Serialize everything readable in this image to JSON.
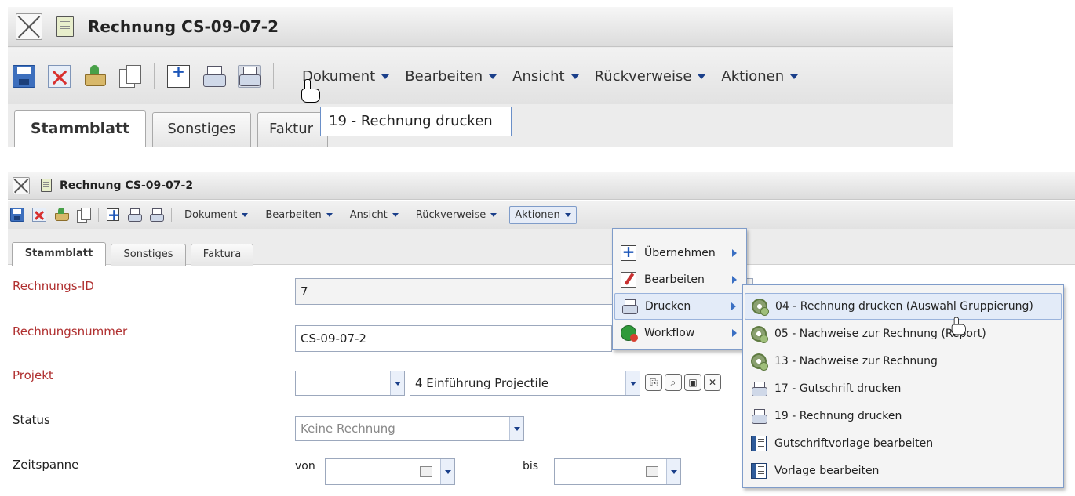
{
  "top": {
    "title": "Rechnung CS-09-07-2",
    "menus": [
      "Dokument",
      "Bearbeiten",
      "Ansicht",
      "Rückverweise",
      "Aktionen"
    ],
    "tabs": [
      "Stammblatt",
      "Sonstiges",
      "Faktur"
    ],
    "tooltip": "19 - Rechnung drucken"
  },
  "bottom": {
    "title": "Rechnung CS-09-07-2",
    "menus": [
      "Dokument",
      "Bearbeiten",
      "Ansicht",
      "Rückverweise",
      "Aktionen"
    ],
    "tabs": [
      "Stammblatt",
      "Sonstiges",
      "Faktura"
    ],
    "fields": {
      "rechnungs_id": {
        "label": "Rechnungs-ID",
        "value": "7"
      },
      "rechnungsnummer": {
        "label": "Rechnungsnummer",
        "value": "CS-09-07-2"
      },
      "projekt": {
        "label": "Projekt",
        "value": "4 Einführung Projectile"
      },
      "status": {
        "label": "Status",
        "value": "Keine Rechnung"
      },
      "zeitspanne": {
        "label": "Zeitspanne",
        "von": "von",
        "bis": "bis"
      }
    },
    "aktionen_menu": [
      "Übernehmen",
      "Bearbeiten",
      "Drucken",
      "Workflow"
    ],
    "drucken_submenu": [
      "04 - Rechnung drucken (Auswahl Gruppierung)",
      "05 - Nachweise zur Rechnung (Report)",
      "13 - Nachweise zur Rechnung",
      "17 - Gutschrift drucken",
      "19 - Rechnung drucken",
      "Gutschriftvorlage bearbeiten",
      "Vorlage bearbeiten"
    ]
  },
  "colors": {
    "required_label": "#b03030",
    "menu_border": "#7f9cc9",
    "highlight": "#e3ebf8"
  }
}
